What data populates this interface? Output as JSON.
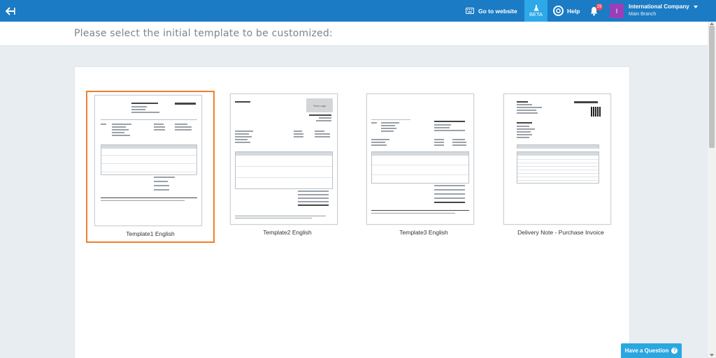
{
  "topbar": {
    "website_label": "Go to website",
    "beta_label": "BETA",
    "help_label": "Help",
    "notification_count": "29",
    "avatar_initial": "I",
    "company_name": "International Company",
    "branch_name": "Main Branch"
  },
  "page": {
    "heading": "Please select the initial template to be customized:"
  },
  "templates": [
    {
      "label": "Template1 English",
      "selected": true
    },
    {
      "label": "Template2 English",
      "selected": false
    },
    {
      "label": "Template3 English",
      "selected": false
    },
    {
      "label": "Delivery Note - Purchase Invoice",
      "selected": false
    }
  ],
  "help_widget": {
    "label": "Have a Question"
  },
  "colors": {
    "topbar": "#1b7bc4",
    "beta": "#2da8e8",
    "selected_border": "#f07f2a",
    "badge": "#e84a5f",
    "avatar": "#9b3fb8"
  }
}
